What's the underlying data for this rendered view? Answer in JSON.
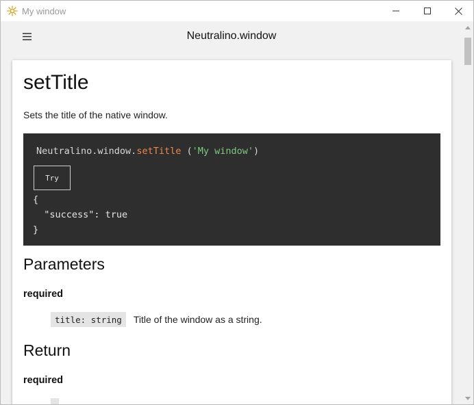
{
  "window": {
    "title": "My window",
    "accent_color": "#e0a020"
  },
  "header": {
    "title": "Neutralino.window",
    "menu_icon": "hamburger-menu-icon"
  },
  "content": {
    "method_title": "setTitle",
    "description": "Sets the title of the native window.",
    "code": {
      "object": "Neutralino.window.",
      "function": "setTitle",
      "open": " (",
      "argument": "'My window'",
      "close": ")",
      "try_label": "Try",
      "result_open": "{",
      "result_body": "  \"success\": true",
      "result_close": "}"
    },
    "parameters": {
      "heading": "Parameters",
      "subheading": "required",
      "items": [
        {
          "code": "title: string",
          "description": "Title of the window as a string."
        }
      ]
    },
    "return": {
      "heading": "Return",
      "subheading": "required",
      "items": [
        {
          "code": "",
          "description": ""
        }
      ]
    }
  }
}
